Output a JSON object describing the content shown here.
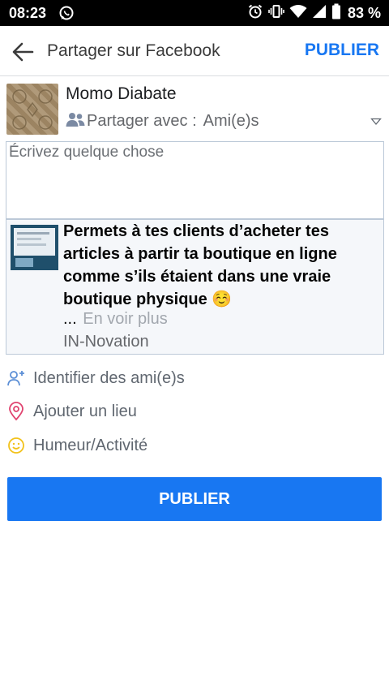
{
  "status_bar": {
    "time": "08:23",
    "battery": "83 %",
    "icons": [
      "whatsapp-icon",
      "alarm-icon",
      "vibrate-icon",
      "wifi-icon",
      "signal-icon",
      "battery-icon"
    ]
  },
  "header": {
    "title": "Partager sur Facebook",
    "publish_label": "PUBLIER",
    "accent_color": "#1877f2"
  },
  "user": {
    "name": "Momo Diabate",
    "share_with_label": "Partager avec :",
    "share_with_value": "Ami(e)s"
  },
  "composer": {
    "placeholder": "Écrivez quelque chose"
  },
  "link_preview": {
    "title": "Permets à tes clients d’acheter tes articles à partir ta boutique en ligne comme s’ils étaient dans une vraie boutique physique ☺️",
    "ellipsis": "...",
    "see_more": "En voir plus",
    "source": "IN-Novation"
  },
  "actions": [
    {
      "label": "Identifier des ami(e)s",
      "icon": "tag-friends-icon",
      "color": "#5c8fd6"
    },
    {
      "label": "Ajouter un lieu",
      "icon": "location-pin-icon",
      "color": "#e0436f"
    },
    {
      "label": "Humeur/Activité",
      "icon": "smiley-icon",
      "color": "#f2c21b"
    }
  ],
  "footer": {
    "publish_label": "PUBLIER"
  }
}
